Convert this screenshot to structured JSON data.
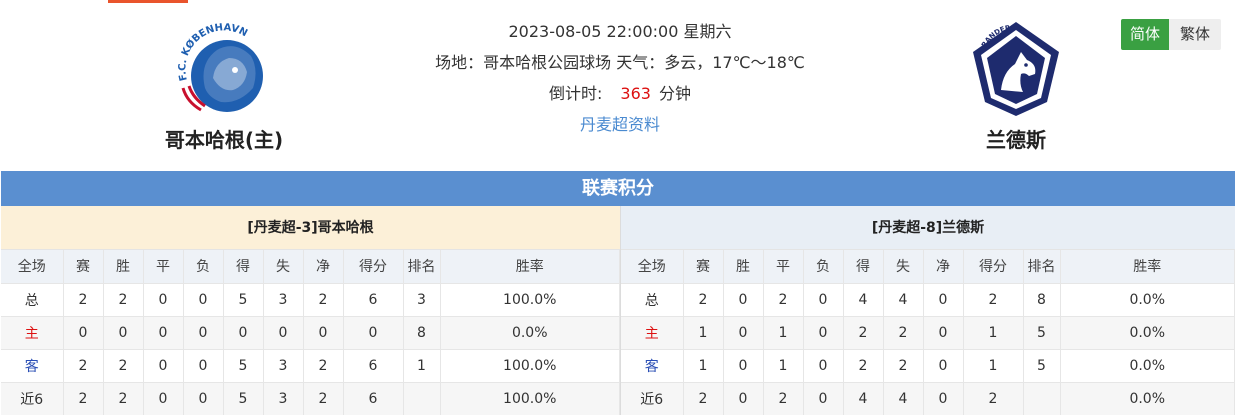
{
  "match": {
    "datetime": "2023-08-05 22:00:00 星期六",
    "venue": "场地：哥本哈根公园球场 天气：多云，17℃～18℃",
    "countdown_label": "倒计时:",
    "countdown_value": "363",
    "countdown_unit": "分钟",
    "league_link": "丹麦超资料"
  },
  "home_team": {
    "name": "哥本哈根(主)",
    "logo_text": "F.C. KØBENHAVN",
    "logo_icon": "lion-crest-icon"
  },
  "away_team": {
    "name": "兰德斯",
    "logo_text": "RANDERS FC",
    "logo_icon": "horse-shield-icon"
  },
  "lang": {
    "simplified": "简体",
    "traditional": "繁体"
  },
  "colors": {
    "section_bar": "#5a8fd0",
    "home_title_bg": "#fcf0d8",
    "away_title_bg": "#e8eef5",
    "accent_red": "#dd1111",
    "away_label": "#2b4fb5",
    "lang_active": "#3aa042"
  },
  "standings": {
    "title": "联赛积分",
    "headers": [
      "全场",
      "赛",
      "胜",
      "平",
      "负",
      "得",
      "失",
      "净",
      "得分",
      "排名",
      "胜率"
    ],
    "home": {
      "title": "[丹麦超-3]哥本哈根",
      "rows": [
        [
          "总",
          "2",
          "2",
          "0",
          "0",
          "5",
          "3",
          "2",
          "6",
          "3",
          "100.0%"
        ],
        [
          "主",
          "0",
          "0",
          "0",
          "0",
          "0",
          "0",
          "0",
          "0",
          "8",
          "0.0%"
        ],
        [
          "客",
          "2",
          "2",
          "0",
          "0",
          "5",
          "3",
          "2",
          "6",
          "1",
          "100.0%"
        ],
        [
          "近6",
          "2",
          "2",
          "0",
          "0",
          "5",
          "3",
          "2",
          "6",
          "",
          "100.0%"
        ]
      ]
    },
    "away": {
      "title": "[丹麦超-8]兰德斯",
      "rows": [
        [
          "总",
          "2",
          "0",
          "2",
          "0",
          "4",
          "4",
          "0",
          "2",
          "8",
          "0.0%"
        ],
        [
          "主",
          "1",
          "0",
          "1",
          "0",
          "2",
          "2",
          "0",
          "1",
          "5",
          "0.0%"
        ],
        [
          "客",
          "1",
          "0",
          "1",
          "0",
          "2",
          "2",
          "0",
          "1",
          "5",
          "0.0%"
        ],
        [
          "近6",
          "2",
          "0",
          "2",
          "0",
          "4",
          "4",
          "0",
          "2",
          "",
          "0.0%"
        ]
      ]
    }
  }
}
